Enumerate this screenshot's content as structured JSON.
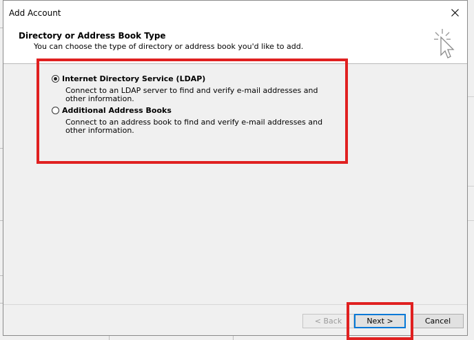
{
  "dialog": {
    "title": "Add Account",
    "header_title": "Directory or Address Book Type",
    "header_subtitle": "You can choose the type of directory or address book you'd like to add."
  },
  "options": [
    {
      "label": "Internet Directory Service (LDAP)",
      "description": "Connect to an LDAP server to find and verify e-mail addresses and other information.",
      "selected": true
    },
    {
      "label": "Additional Address Books",
      "description": "Connect to an address book to find and verify e-mail addresses and other information.",
      "selected": false
    }
  ],
  "buttons": {
    "back": "< Back",
    "next": "Next >",
    "cancel": "Cancel"
  },
  "colors": {
    "highlight_red": "#e02020",
    "default_button_border": "#0078d7"
  }
}
